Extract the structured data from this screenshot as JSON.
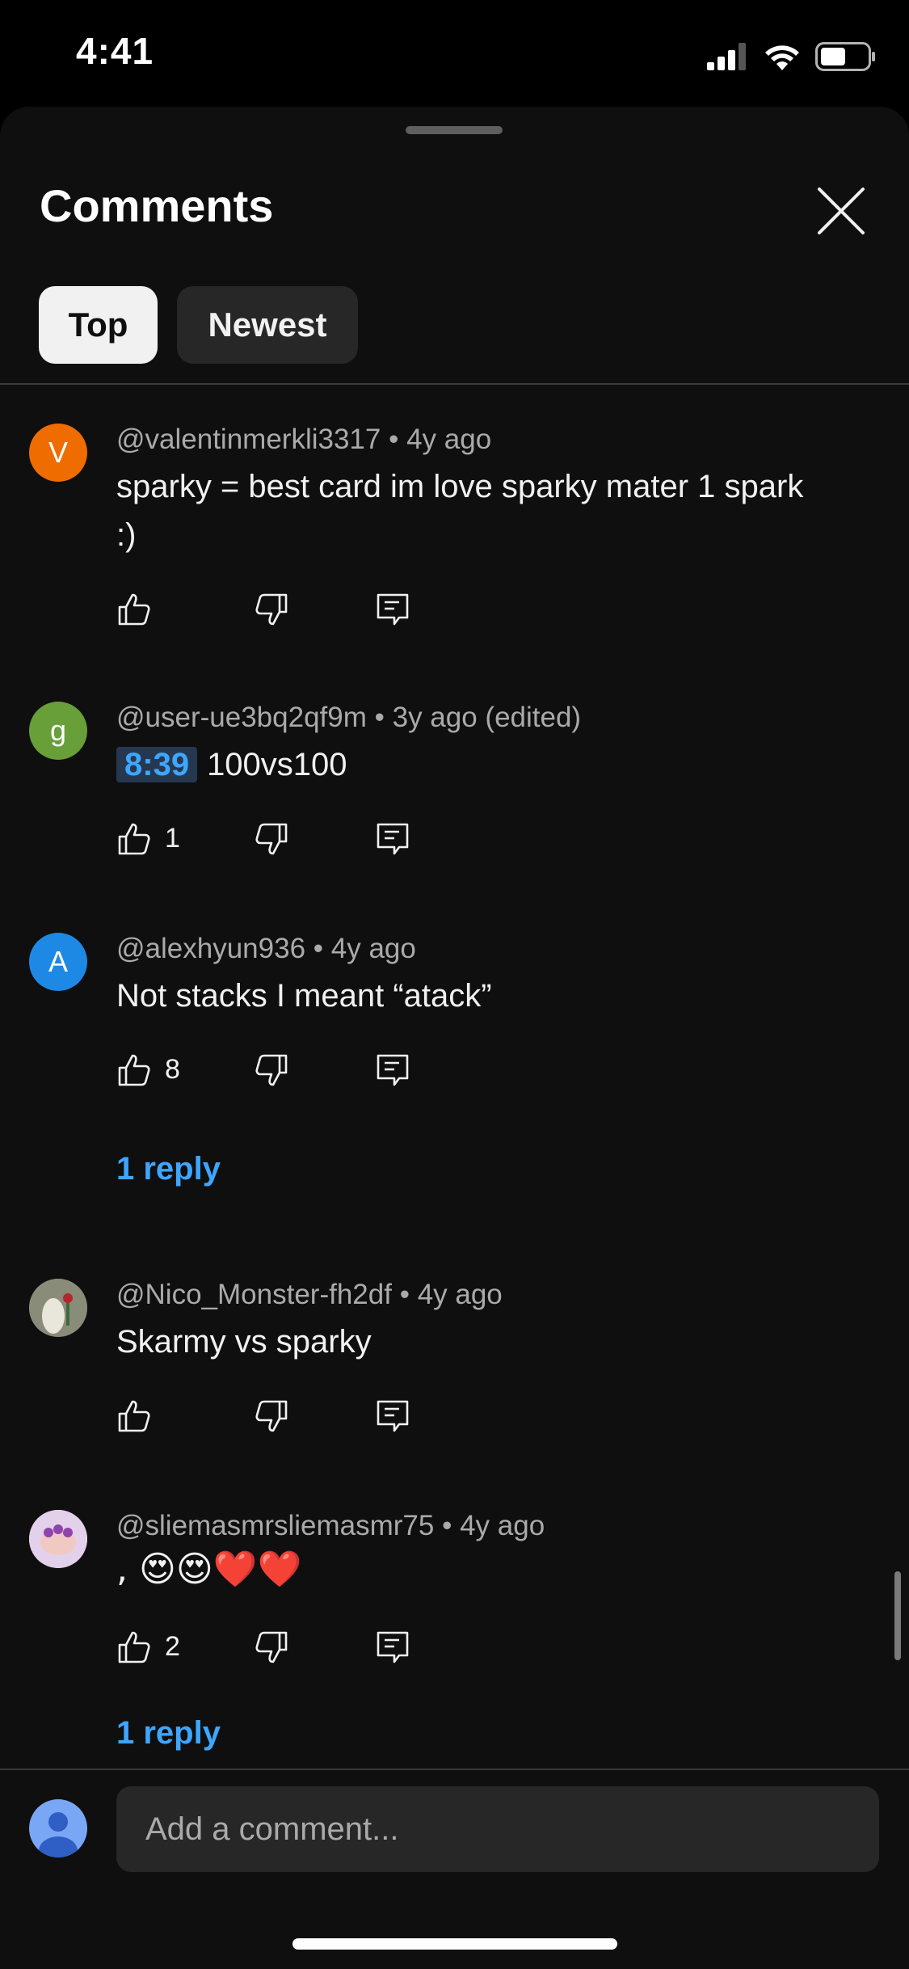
{
  "status_bar": {
    "time": "4:41",
    "icons": [
      "cellular-signal-icon",
      "wifi-icon",
      "battery-icon"
    ]
  },
  "sheet": {
    "title": "Comments",
    "close_icon": "close-icon",
    "tabs": [
      {
        "label": "Top",
        "selected": true
      },
      {
        "label": "Newest",
        "selected": false
      }
    ]
  },
  "comments": [
    {
      "avatar_letter": "V",
      "avatar_color": "#ef6c00",
      "author": "@valentinmerkli3317",
      "age": "4y ago",
      "text": "sparky = best card im love sparky mater 1 spark :)",
      "likes": ""
    },
    {
      "avatar_letter": "g",
      "avatar_color": "#689f38",
      "author": "@user-ue3bq2qf9m",
      "age": "3y ago (edited)",
      "timestamp_link": "8:39",
      "text": "100vs100",
      "likes": "1"
    },
    {
      "avatar_letter": "A",
      "avatar_color": "#1e88e5",
      "author": "@alexhyun936",
      "age": "4y ago",
      "text": "Not stacks I meant “atack”",
      "likes": "8",
      "replies": "1 reply"
    },
    {
      "avatar_letter": "",
      "avatar_color": "#6b6b58",
      "author": "@Nico_Monster-fh2df",
      "age": "4y ago",
      "text": "Skarmy vs sparky",
      "likes": ""
    },
    {
      "avatar_letter": "",
      "avatar_color": "#d6b8e0",
      "author": "@sliemasmrsliemasmr75",
      "age": "4y ago",
      "text": ", 😍😍❤️❤️",
      "likes": "2",
      "replies": "1 reply"
    }
  ],
  "separator": "•",
  "composer": {
    "placeholder": "Add a comment..."
  },
  "colors": {
    "background": "#0f0f0f",
    "link_blue": "#3ea6ff",
    "secondary_text": "#aaaaaa"
  }
}
